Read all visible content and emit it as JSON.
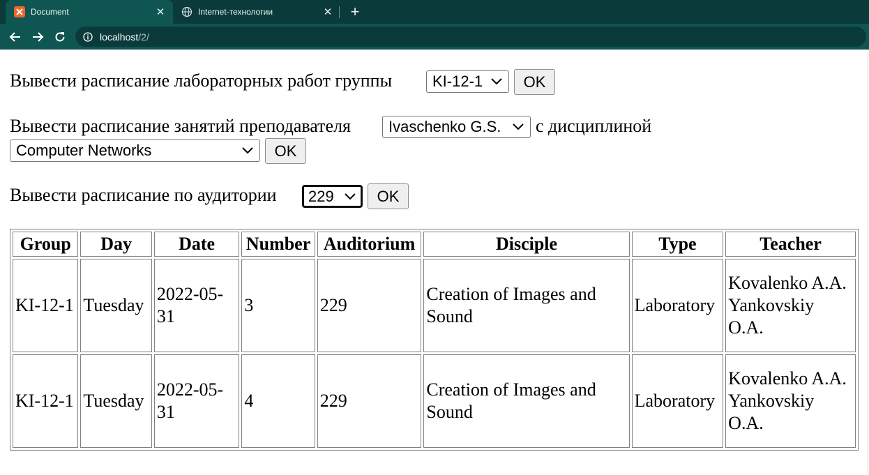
{
  "browser": {
    "tabs": [
      {
        "title": "Document",
        "active": true,
        "favicon": "xampp-icon"
      },
      {
        "title": "Internet-технологии",
        "active": false,
        "favicon": "globe-icon"
      }
    ],
    "close_glyph": "✕",
    "new_tab_glyph": "+",
    "address": {
      "host": "localhost",
      "path": "/2/"
    }
  },
  "forms": {
    "group": {
      "label": "Вывести расписание лабораторных работ группы",
      "selected": "KI-12-1",
      "button": "OK"
    },
    "teacher": {
      "label": "Вывести расписание занятий преподавателя",
      "selected_teacher": "Ivaschenko G.S.",
      "discipline_label": "с дисциплиной",
      "selected_discipline": "Computer Networks",
      "button": "OK"
    },
    "auditorium": {
      "label": "Вывести расписание по аудитории",
      "selected": "229",
      "button": "OK"
    }
  },
  "table": {
    "headers": [
      "Group",
      "Day",
      "Date",
      "Number",
      "Auditorium",
      "Disciple",
      "Type",
      "Teacher"
    ],
    "rows": [
      [
        "KI-12-1",
        "Tuesday",
        "2022-05-31",
        "3",
        "229",
        "Creation of Images and Sound",
        "Laboratory",
        "Kovalenko A.A. Yankovskiy O.A."
      ],
      [
        "KI-12-1",
        "Tuesday",
        "2022-05-31",
        "4",
        "229",
        "Creation of Images and Sound",
        "Laboratory",
        "Kovalenko A.A. Yankovskiy O.A."
      ]
    ]
  },
  "colors": {
    "tabbar": "#0a3b3a",
    "toolbar": "#0f5652",
    "favicon": "#f0652a"
  }
}
